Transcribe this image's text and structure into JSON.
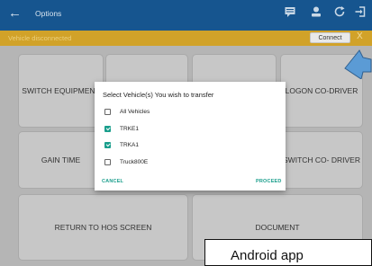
{
  "topbar": {
    "back_icon": "arrow-left-icon",
    "title": "Options",
    "icons": [
      "chat-icon",
      "driver-icon",
      "refresh-icon",
      "logout-icon"
    ]
  },
  "status": {
    "text": "Vehicle disconnected",
    "connect_label": "Connect",
    "close_label": "X"
  },
  "tiles": {
    "switch_equipment": "SWITCH EQUIPMENT",
    "logon_codriver": "LOGON CO-DRIVER",
    "gain_time": "GAIN TIME",
    "switch_codriver": "SWITCH CO- DRIVER",
    "return_hos": "RETURN TO HOS SCREEN",
    "document": "DOCUMENT"
  },
  "dialog": {
    "title": "Select Vehicle(s) You wish to transfer",
    "options": [
      {
        "label": "All Vehicles",
        "checked": false
      },
      {
        "label": "TRKE1",
        "checked": true
      },
      {
        "label": "TRKA1",
        "checked": true
      },
      {
        "label": "Truck800E",
        "checked": false
      }
    ],
    "cancel_label": "CANCEL",
    "proceed_label": "PROCEED"
  },
  "caption": "Android app",
  "colors": {
    "topbar": "#16558f",
    "statusbar": "#d1a229",
    "accent": "#1a9e8c",
    "arrow": "#5b9bd5"
  }
}
